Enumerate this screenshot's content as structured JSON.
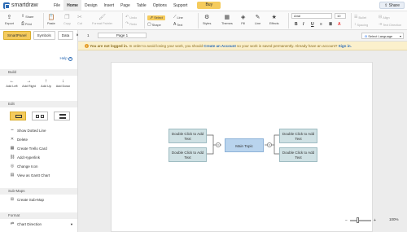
{
  "app": {
    "logo_text": "smartdraw"
  },
  "menu": [
    "File",
    "Home",
    "Design",
    "Insert",
    "Page",
    "Table",
    "Options",
    "Support"
  ],
  "menu_active": "Home",
  "buy_label": "Buy",
  "share_label": "Share",
  "ribbon": {
    "export": "Export",
    "share": "Share",
    "print": "Print",
    "paste": "Paste",
    "copy": "Copy",
    "cut": "Cut",
    "format_painter": "Format Painter",
    "undo": "Undo",
    "redo": "Redo",
    "select": "Select",
    "shape": "Shape",
    "line": "Line",
    "text": "Text",
    "styles": "Styles",
    "themes": "Themes",
    "fill": "Fill",
    "line2": "Line",
    "effects": "Effects",
    "font": "Arial",
    "font_size": "10",
    "bold": "B",
    "italic": "I",
    "underline": "U",
    "bullet": "Bullet",
    "spacing": "Spacing",
    "align": "Align",
    "text_direction": "Text Direction"
  },
  "sidebar": {
    "tabs": [
      "SmartPanel",
      "Symbols",
      "Data"
    ],
    "close": "×",
    "help": "Help",
    "build_header": "Build",
    "build_buttons": [
      {
        "label": "Add Left",
        "icon": "←"
      },
      {
        "label": "Add Right",
        "icon": "→"
      },
      {
        "label": "Add Up",
        "icon": "↑"
      },
      {
        "label": "Add Down",
        "icon": "↓"
      }
    ],
    "edit_header": "Edit",
    "edit_items": [
      {
        "label": "Show Dotted Line",
        "icon": "┅"
      },
      {
        "label": "Delete",
        "icon": "✕"
      },
      {
        "label": "Create Trello Card",
        "icon": "▦"
      },
      {
        "label": "Add Hyperlink",
        "icon": "⛓"
      },
      {
        "label": "Change Icon",
        "icon": "◎"
      },
      {
        "label": "View as Gantt Chart",
        "icon": "▤"
      }
    ],
    "submaps_header": "Sub-Maps",
    "submaps_items": [
      {
        "label": "Create Sub-Map",
        "icon": "⊞"
      }
    ],
    "format_header": "Format",
    "format_items": [
      {
        "label": "Chart Direction",
        "icon": "⇄"
      }
    ]
  },
  "canvas": {
    "page_tab": "1",
    "page_name": "Page 1",
    "language": "Select Language",
    "notice_bold": "You are not logged in.",
    "notice_text": " In order to avoid losing your work, you should ",
    "notice_link": "Create an Account",
    "notice_text2": " so your work is saved permanently. Already have an account? ",
    "notice_signin": "Sign in.",
    "main_topic": "Main Topic",
    "node_text": "Double Click to Add Text"
  },
  "zoom": {
    "value": "100%",
    "level": 0.35
  }
}
